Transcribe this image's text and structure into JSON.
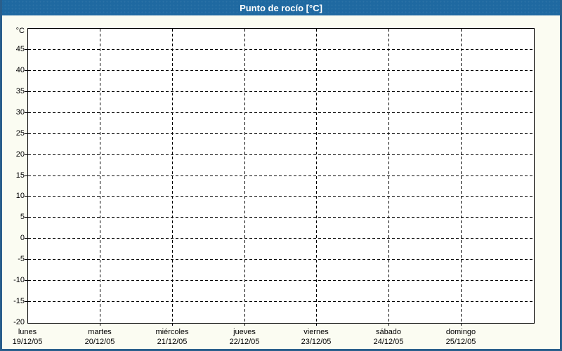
{
  "window": {
    "title": "Punto de rocío [°C]"
  },
  "colors": {
    "title_bar_bg": "#1f69a1",
    "title_text": "#ffffff",
    "frame_border": "#2a5f8c",
    "page_bg": "#fbfcf2",
    "plot_bg": "#ffffff",
    "grid": "#000000",
    "axis": "#000000",
    "label_text": "#000000"
  },
  "chart_data": {
    "type": "line",
    "title": "Punto de rocío [°C]",
    "ylabel": "°C",
    "ylim": [
      -20,
      50
    ],
    "ytick_interval": 5,
    "yticks": [
      45,
      40,
      35,
      30,
      25,
      20,
      15,
      10,
      5,
      0,
      -5,
      -10,
      -15,
      -20
    ],
    "grid": "dashed",
    "legend": "none",
    "x_categories": [
      {
        "day": "lunes",
        "date": "19/12/05"
      },
      {
        "day": "martes",
        "date": "20/12/05"
      },
      {
        "day": "miércoles",
        "date": "21/12/05"
      },
      {
        "day": "jueves",
        "date": "22/12/05"
      },
      {
        "day": "viernes",
        "date": "23/12/05"
      },
      {
        "day": "sábado",
        "date": "24/12/05"
      },
      {
        "day": "domingo",
        "date": "25/12/05"
      }
    ],
    "series": []
  }
}
